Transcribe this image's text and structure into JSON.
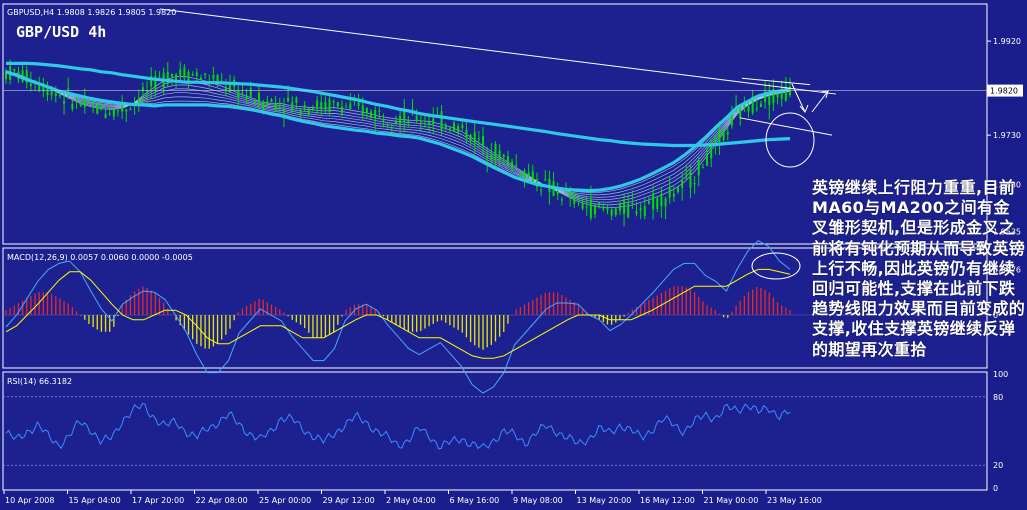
{
  "chart_data": [
    {
      "type": "line",
      "pane": "price",
      "header": "GBPUSD,H4  1.9808 1.9826 1.9805 1.9820",
      "title": "GBP/USD 4h",
      "symbol": "GBPUSD",
      "timeframe": "H4",
      "ohlc": {
        "open": 1.9808,
        "high": 1.9826,
        "low": 1.9805,
        "close": 1.982
      },
      "current_price_label": "1.9820",
      "y_ticks": [
        "1.9920",
        "1.9820",
        "1.9730",
        "1.9630",
        "1.9535"
      ],
      "ylim": [
        1.951,
        1.9995
      ],
      "candle_colors": {
        "bull": "#00dd00",
        "bear": "#00dd00"
      },
      "moving_average_colors": {
        "thick": "#30c8e8",
        "thin": "#c8e8ff"
      },
      "series": [
        {
          "values": [
            1.9858,
            1.9851,
            1.9842,
            1.9835,
            1.9827,
            1.9819,
            1.9814,
            1.9809,
            1.9804,
            1.98,
            1.9797,
            1.9794,
            1.9792,
            1.9791,
            1.9789,
            1.9791,
            1.9791,
            1.9791,
            1.9791,
            1.9791,
            1.9789,
            1.9788,
            1.9785,
            1.9782,
            1.9778,
            1.9773,
            1.9769,
            1.9763,
            1.9758,
            1.9754,
            1.9749,
            1.9746,
            1.9743,
            1.974,
            1.9738,
            1.9734,
            1.9732,
            1.9729,
            1.9727,
            1.9724,
            1.9718,
            1.9712,
            1.9704,
            1.9696,
            1.9687,
            1.9676,
            1.9665,
            1.9655,
            1.9645,
            1.9638,
            1.9631,
            1.9627,
            1.9623,
            1.962,
            1.9619,
            1.9618,
            1.9619,
            1.9622,
            1.9627,
            1.9634,
            1.9642,
            1.9652,
            1.9663,
            1.9674,
            1.9689,
            1.9706,
            1.9725,
            1.9746,
            1.9765,
            1.9786,
            1.9798,
            1.9809,
            1.9815,
            1.9819,
            1.9823
          ]
        },
        {
          "values": [
            1.9857,
            1.9855,
            1.9846,
            1.9836,
            1.9825,
            1.9814,
            1.9803,
            1.9792,
            1.9785,
            1.9781,
            1.978,
            1.9783,
            1.9794,
            1.9814,
            1.9832,
            1.9848,
            1.9856,
            1.9856,
            1.9851,
            1.9845,
            1.9837,
            1.9829,
            1.9818,
            1.981,
            1.98,
            1.9797,
            1.9797,
            1.9793,
            1.9791,
            1.979,
            1.9789,
            1.9791,
            1.9788,
            1.9784,
            1.978,
            1.9774,
            1.977,
            1.9767,
            1.9765,
            1.9764,
            1.9763,
            1.9758,
            1.9752,
            1.9743,
            1.9729,
            1.9713,
            1.9699,
            1.9684,
            1.967,
            1.9655,
            1.964,
            1.9627,
            1.9616,
            1.9604,
            1.9593,
            1.9585,
            1.958,
            1.9578,
            1.9579,
            1.9582,
            1.9588,
            1.9595,
            1.9603,
            1.9613,
            1.9627,
            1.965,
            1.9678,
            1.9708,
            1.974,
            1.977,
            1.9789,
            1.9801,
            1.9809,
            1.9814,
            1.9818
          ]
        },
        {
          "values": [
            1.9875,
            1.9875,
            1.9875,
            1.9874,
            1.9872,
            1.987,
            1.9867,
            1.9864,
            1.9862,
            1.9858,
            1.9856,
            1.9852,
            1.9849,
            1.9846,
            1.9843,
            1.9841,
            1.9839,
            1.9837,
            1.9837,
            1.9836,
            1.9836,
            1.9835,
            1.9834,
            1.9833,
            1.9831,
            1.9829,
            1.9827,
            1.9824,
            1.9821,
            1.9818,
            1.9814,
            1.981,
            1.9806,
            1.9802,
            1.9797,
            1.9792,
            1.9788,
            1.9783,
            1.9779,
            1.9774,
            1.977,
            1.9767,
            1.9764,
            1.9761,
            1.9758,
            1.9755,
            1.9752,
            1.9749,
            1.9746,
            1.9743,
            1.974,
            1.9737,
            1.9733,
            1.973,
            1.9727,
            1.9724,
            1.9721,
            1.9719,
            1.9716,
            1.9714,
            1.9712,
            1.9711,
            1.971,
            1.9709,
            1.9709,
            1.9709,
            1.971,
            1.9711,
            1.9713,
            1.9715,
            1.9717,
            1.9719,
            1.9721,
            1.9722,
            1.9723
          ]
        }
      ],
      "annotations": [
        "descending trend line",
        "converging wedge lines",
        "arrows down and up",
        "circle around MA cross zone"
      ]
    },
    {
      "type": "bar",
      "pane": "MACD",
      "header": "MACD(12,26,9) 0.0057 0.0060 0.0000 -0.0005",
      "params": [
        12,
        26,
        9
      ],
      "values_shown": [
        0.0057,
        0.006,
        0.0,
        -0.0005
      ],
      "y_ticks": [
        "0.0076",
        "0"
      ],
      "ylim": [
        -0.0085,
        0.0105
      ],
      "histogram_colors": {
        "positive": "#e8282a",
        "negative": "#e8e800"
      },
      "line_colors": {
        "macd": "#4da6ff",
        "signal": "#ffff00"
      },
      "series": [
        {
          "name": "histogram",
          "values": [
            0.0008,
            0.0018,
            0.0028,
            0.0038,
            0.0038,
            0.0028,
            0.0018,
            0.0,
            -0.0018,
            -0.0028,
            -0.0028,
            0.0018,
            0.0038,
            0.0048,
            0.0038,
            0.0018,
            -0.0008,
            -0.0028,
            -0.0048,
            -0.0058,
            -0.0048,
            -0.0028,
            0.0008,
            0.0018,
            0.0028,
            0.0018,
            0.0008,
            -0.0008,
            -0.0018,
            -0.0038,
            -0.0038,
            -0.0028,
            0.0008,
            0.0018,
            0.0018,
            0.0008,
            -0.0008,
            -0.0018,
            -0.0028,
            -0.0028,
            -0.0018,
            -0.0008,
            -0.0018,
            -0.0028,
            -0.0048,
            -0.0058,
            -0.0048,
            -0.0028,
            0.0008,
            0.0018,
            0.0028,
            0.0038,
            0.0038,
            0.0028,
            0.0018,
            0.0,
            -0.0008,
            -0.0018,
            -0.0008,
            0.0008,
            0.0018,
            0.0028,
            0.0038,
            0.0048,
            0.0048,
            0.0038,
            0.0018,
            0.0008,
            -0.0008,
            0.0018,
            0.0038,
            0.0048,
            0.0038,
            0.0018,
            0.0008
          ]
        },
        {
          "name": "signal",
          "values": [
            -0.0028,
            -0.0018,
            0.0,
            0.0018,
            0.0038,
            0.0058,
            0.0072,
            0.0072,
            0.0058,
            0.0038,
            0.0018,
            0.0,
            -0.0008,
            -0.0008,
            0.0,
            0.0008,
            0.0008,
            0.0,
            -0.0018,
            -0.0038,
            -0.0048,
            -0.0048,
            -0.0038,
            -0.0028,
            -0.0018,
            -0.0018,
            -0.0018,
            -0.0028,
            -0.0038,
            -0.0038,
            -0.0038,
            -0.0028,
            -0.0018,
            -0.0008,
            0.0,
            0.0,
            -0.0008,
            -0.0018,
            -0.0028,
            -0.0038,
            -0.0038,
            -0.0038,
            -0.0048,
            -0.0058,
            -0.0068,
            -0.0072,
            -0.0072,
            -0.0068,
            -0.0058,
            -0.0048,
            -0.0038,
            -0.0028,
            -0.0018,
            -0.0008,
            0.0,
            0.0,
            0.0,
            -0.0008,
            -0.0008,
            -0.0008,
            0.0,
            0.0008,
            0.0018,
            0.0028,
            0.0038,
            0.0048,
            0.0048,
            0.0048,
            0.0048,
            0.0058,
            0.0068,
            0.0076,
            0.0076,
            0.0072,
            0.0068
          ]
        },
        {
          "name": "macd",
          "values": [
            -0.002,
            -0.0,
            0.0028,
            0.0056,
            0.0076,
            0.0086,
            0.009,
            0.0072,
            0.004,
            0.001,
            -0.001,
            0.0018,
            0.003,
            0.004,
            0.0038,
            0.0026,
            0.0,
            -0.0028,
            -0.0066,
            -0.0096,
            -0.0096,
            -0.0076,
            -0.003,
            -0.001,
            0.001,
            0.0,
            -0.001,
            -0.0036,
            -0.0056,
            -0.0076,
            -0.0076,
            -0.0056,
            -0.001,
            0.001,
            0.0018,
            0.0008,
            -0.0016,
            -0.0036,
            -0.0056,
            -0.0066,
            -0.0056,
            -0.0046,
            -0.0066,
            -0.0086,
            -0.0116,
            -0.013,
            -0.012,
            -0.0096,
            -0.005,
            -0.003,
            -0.001,
            0.001,
            0.002,
            0.002,
            0.0018,
            0.0,
            -0.0008,
            -0.0026,
            -0.0016,
            0.0,
            0.0018,
            0.0036,
            0.0056,
            0.0076,
            0.0086,
            0.0086,
            0.0066,
            0.0056,
            0.004,
            0.0076,
            0.0106,
            0.0124,
            0.0114,
            0.009,
            0.0076
          ]
        }
      ]
    },
    {
      "type": "line",
      "pane": "RSI",
      "header": "RSI(14) 66.3182",
      "period": 14,
      "value_shown": 66.3182,
      "y_ticks": [
        "100",
        "80",
        "20",
        "0"
      ],
      "ylim": [
        0,
        100
      ],
      "line_color": "#3c8cff",
      "levels": [
        80,
        20
      ],
      "series": [
        {
          "name": "RSI",
          "values": [
            48,
            42,
            50,
            55,
            45,
            38,
            46,
            58,
            52,
            40,
            44,
            60,
            68,
            72,
            62,
            54,
            58,
            50,
            44,
            52,
            58,
            64,
            56,
            48,
            42,
            50,
            62,
            60,
            52,
            46,
            40,
            48,
            56,
            62,
            58,
            50,
            44,
            38,
            42,
            52,
            46,
            36,
            40,
            44,
            38,
            34,
            42,
            50,
            46,
            40,
            48,
            54,
            50,
            44,
            38,
            44,
            52,
            48,
            56,
            50,
            44,
            52,
            60,
            56,
            50,
            58,
            64,
            62,
            70,
            68,
            74,
            66,
            70,
            64,
            66.3
          ]
        }
      ]
    }
  ],
  "x_ticks": [
    "10 Apr 2008",
    "15 Apr 04:00",
    "17 Apr 20:00",
    "22 Apr 08:00",
    "25 Apr 00:00",
    "29 Apr 12:00",
    "2 May 04:00",
    "6 May 16:00",
    "9 May 08:00",
    "13 May 20:00",
    "16 May 12:00",
    "21 May 00:00",
    "23 May 16:00"
  ],
  "annotation_text": "英镑继续上行阻力重重,目前MA60与MA200之间有金叉雏形契机,但是形成金叉之前将有钝化预期从而导致英镑上行不畅,因此英镑仍有继续回归可能性,支撑在此前下跌趋势线阻力效果而目前变成的支撑,收住支撑英镑继续反弹的期望再次重拾"
}
